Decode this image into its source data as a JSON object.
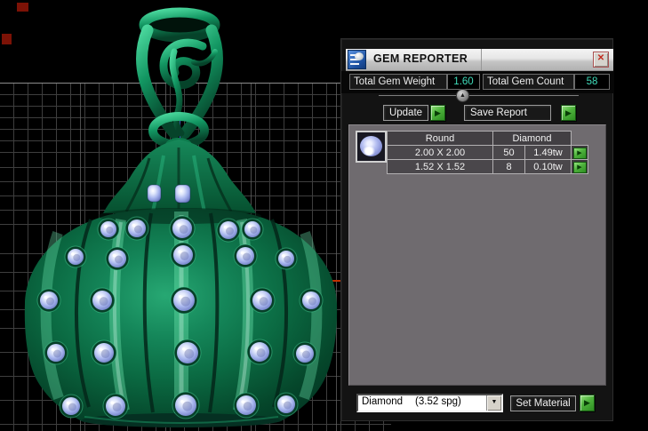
{
  "window": {
    "title": "GEM REPORTER"
  },
  "icons": {
    "close": "✕",
    "go": "▶",
    "collapse": "▲",
    "dropdown_arrow": "▼"
  },
  "totals": {
    "weight_label": "Total Gem Weight",
    "weight_value": "1.60",
    "count_label": "Total Gem Count",
    "count_value": "58"
  },
  "actions": {
    "update": "Update",
    "save_report": "Save Report",
    "set_material": "Set Material"
  },
  "gem_table": {
    "shape_header": "Round",
    "material_header": "Diamond",
    "rows": [
      {
        "size": "2.00 X 2.00",
        "count": "50",
        "weight": "1.49tw"
      },
      {
        "size": "1.52 X 1.52",
        "count": "8",
        "weight": "0.10tw"
      }
    ]
  },
  "material_dropdown": {
    "name": "Diamond",
    "density": "(3.52 spg)"
  },
  "colors": {
    "value_teal": "#3fdcba",
    "go_button_green": "#4eb23c",
    "model_green": "#0b6b43",
    "gem_blue": "#a8b6ee",
    "axis_red": "#c03000",
    "axis_blue": "#4455cc",
    "table_bg": "#6f6b6f"
  }
}
